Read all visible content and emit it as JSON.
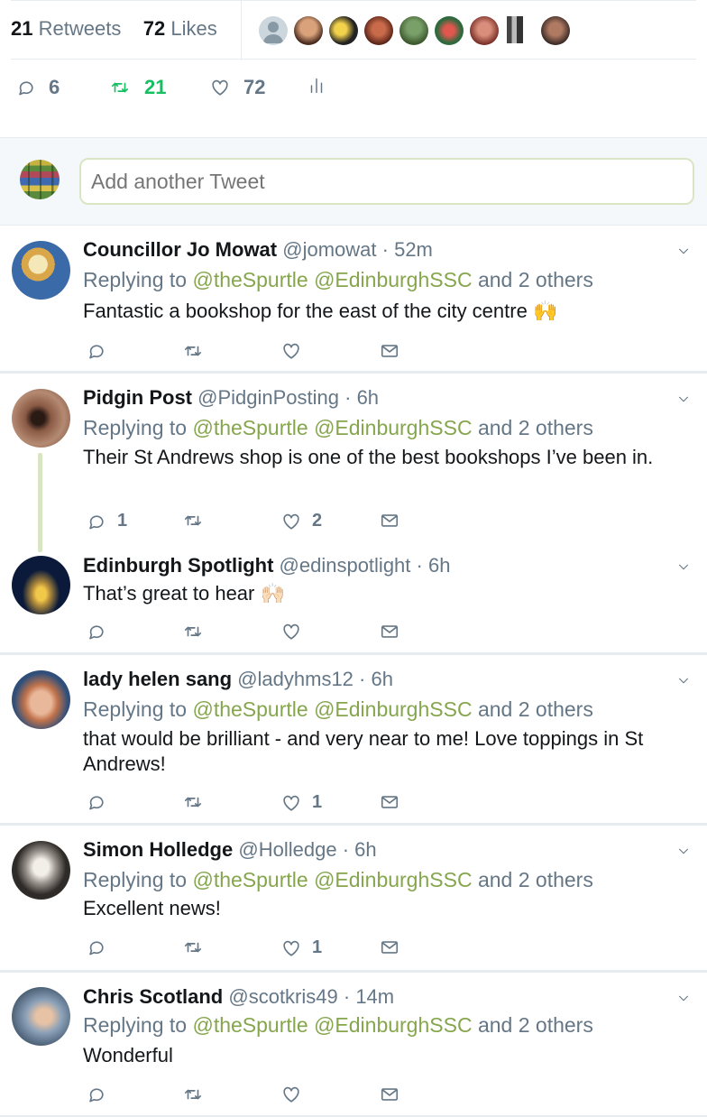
{
  "stats": {
    "retweet_count": "21",
    "retweet_label": "Retweets",
    "like_count": "72",
    "like_label": "Likes"
  },
  "actions": {
    "reply_count": "6",
    "retweet_count": "21",
    "like_count": "72"
  },
  "reply_box": {
    "placeholder": "Add another Tweet"
  },
  "colors": {
    "accent": "#86a64d",
    "retweet_active": "#17bf63",
    "muted": "#657786",
    "divider": "#e6ecf0"
  },
  "icons": [
    "reply-icon",
    "retweet-icon",
    "like-icon",
    "analytics-icon",
    "message-icon",
    "chevron-down-icon"
  ],
  "tweets": [
    {
      "name": "Councillor Jo Mowat",
      "handle": "@jomowat",
      "time": "· 52m",
      "replying_prefix": "Replying to",
      "mention1": "@theSpurtle",
      "mention2": "@EdinburghSSC",
      "replying_suffix": "and 2 others",
      "text": "Fantastic a bookshop for the east of the city centre 🙌",
      "replies": "",
      "likes": ""
    },
    {
      "name": "Pidgin Post",
      "handle": "@PidginPosting",
      "time": "· 6h",
      "replying_prefix": "Replying to",
      "mention1": "@theSpurtle",
      "mention2": "@EdinburghSSC",
      "replying_suffix": "and 2 others",
      "text": "Their St Andrews shop is one of the best bookshops I’ve been in.",
      "replies": "1",
      "likes": "2"
    },
    {
      "name": "Edinburgh Spotlight",
      "handle": "@edinspotlight",
      "time": "· 6h",
      "text": "That’s great to hear 🙌🏻",
      "replies": "",
      "likes": ""
    },
    {
      "name": "lady helen sang",
      "handle": "@ladyhms12",
      "time": "· 6h",
      "replying_prefix": "Replying to",
      "mention1": "@theSpurtle",
      "mention2": "@EdinburghSSC",
      "replying_suffix": "and 2 others",
      "text": "that would be brilliant - and very near to me!  Love toppings in St Andrews!",
      "replies": "",
      "likes": "1"
    },
    {
      "name": "Simon Holledge",
      "handle": "@Holledge",
      "time": "· 6h",
      "replying_prefix": "Replying to",
      "mention1": "@theSpurtle",
      "mention2": "@EdinburghSSC",
      "replying_suffix": "and 2 others",
      "text": "Excellent news!",
      "replies": "",
      "likes": "1"
    },
    {
      "name": "Chris Scotland",
      "handle": "@scotkris49",
      "time": "· 14m",
      "replying_prefix": "Replying to",
      "mention1": "@theSpurtle",
      "mention2": "@EdinburghSSC",
      "replying_suffix": "and 2 others",
      "text": "Wonderful",
      "replies": "",
      "likes": ""
    }
  ]
}
